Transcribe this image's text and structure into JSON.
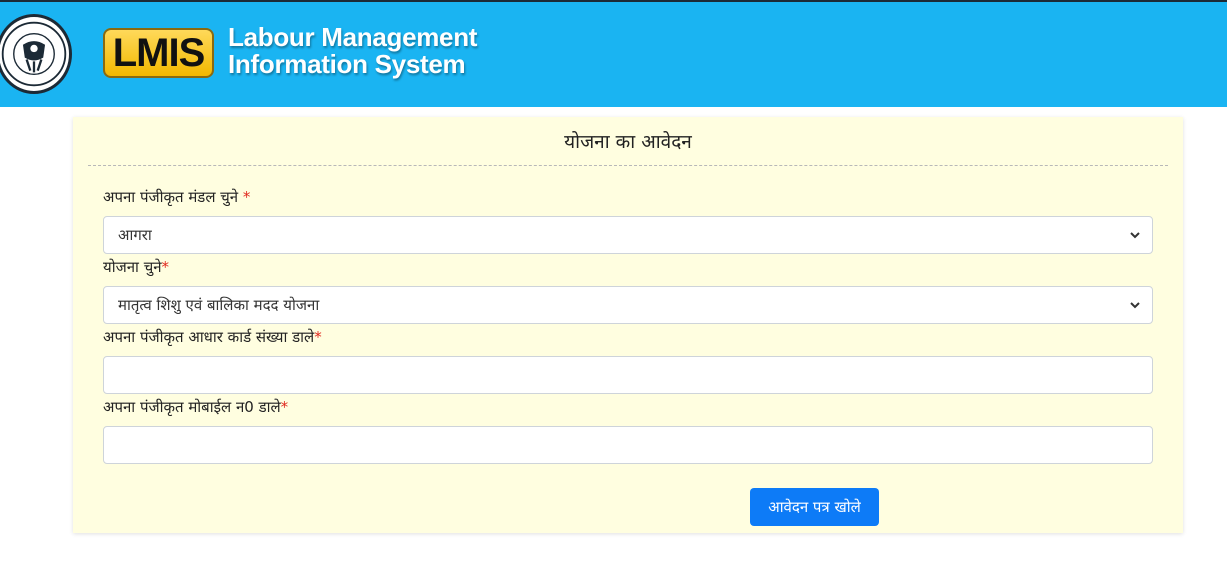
{
  "header": {
    "logo_text": "LMIS",
    "title_line1": "Labour Management",
    "title_line2": "Information System",
    "emblem_text": "उत्तर प्रदेश सरकार",
    "colors": {
      "header_bg": "#1ab4f2",
      "logo_bg": "#f2b800"
    }
  },
  "form": {
    "title": "योजना का आवेदन",
    "fields": [
      {
        "label": "अपना पंजीकृत मंडल चुने ",
        "required_mark": "*",
        "type": "select",
        "value": "आगरा"
      },
      {
        "label": "योजना चुने",
        "required_mark": "*",
        "type": "select",
        "value": "मातृत्व शिशु एवं बालिका मदद योजना"
      },
      {
        "label": "अपना पंजीकृत आधार कार्ड संख्या डाले",
        "required_mark": "*",
        "type": "text",
        "value": ""
      },
      {
        "label": "अपना पंजीकृत मोबाईल न0 डाले",
        "required_mark": "*",
        "type": "text",
        "value": ""
      }
    ],
    "submit_label": "आवेदन पत्र खोले",
    "colors": {
      "card_bg": "#fffee0",
      "button_bg": "#0d7bf7",
      "required": "#e0281e"
    }
  }
}
